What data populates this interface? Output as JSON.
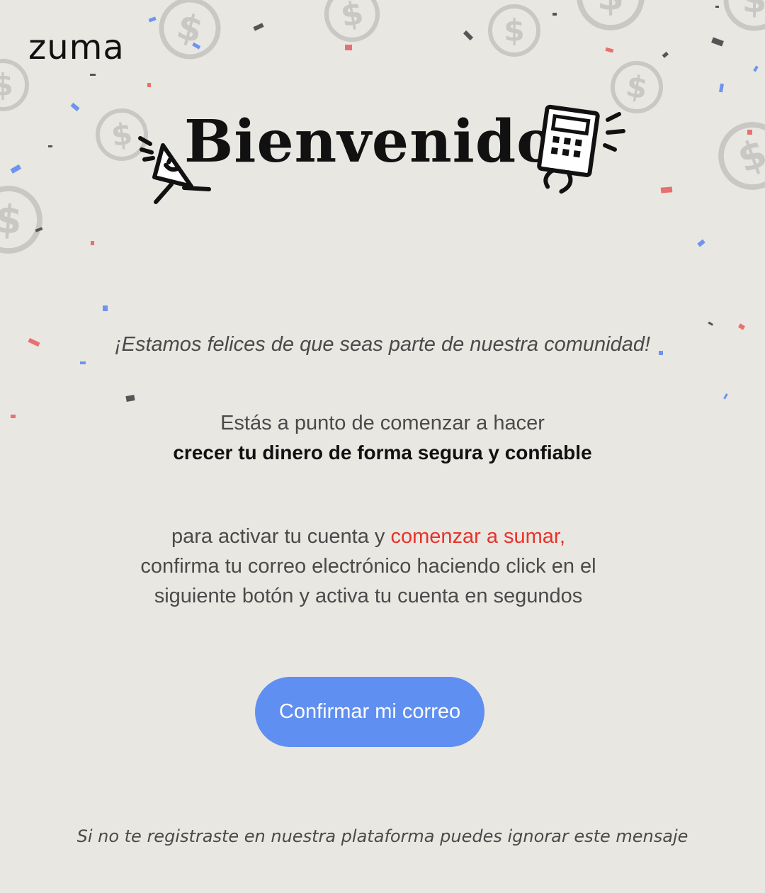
{
  "brand": {
    "logo_text": "zuma"
  },
  "hero": {
    "title": "Bienvenido"
  },
  "tagline": "¡Estamos felices de que seas parte de nuestra comunidad!",
  "intro": {
    "line1": "Estás a punto de comenzar a hacer",
    "line2": "crecer tu dinero de forma segura y confiable"
  },
  "instructions": {
    "prefix": "para activar tu cuenta y ",
    "accent": "comenzar a sumar,",
    "line2": "confirma tu correo electrónico haciendo click en el",
    "line3": "siguiente botón y activa tu cuenta en segundos"
  },
  "cta": {
    "label": "Confirmar mi correo"
  },
  "footer": {
    "note": "Si no te registraste en nuestra plataforma puedes ignorar este mensaje"
  },
  "colors": {
    "background": "#e9e7e2",
    "button": "#5f8ff0",
    "accent_red": "#e8322c",
    "confetti_blue": "#6f94ee",
    "confetti_red": "#e87070",
    "confetti_dark": "#555555",
    "coin_gray": "#c9c7c3"
  },
  "icons": {
    "decor": [
      "dollar-coin-icon",
      "confetti-icon",
      "megaphone-icon",
      "calculator-icon"
    ]
  }
}
